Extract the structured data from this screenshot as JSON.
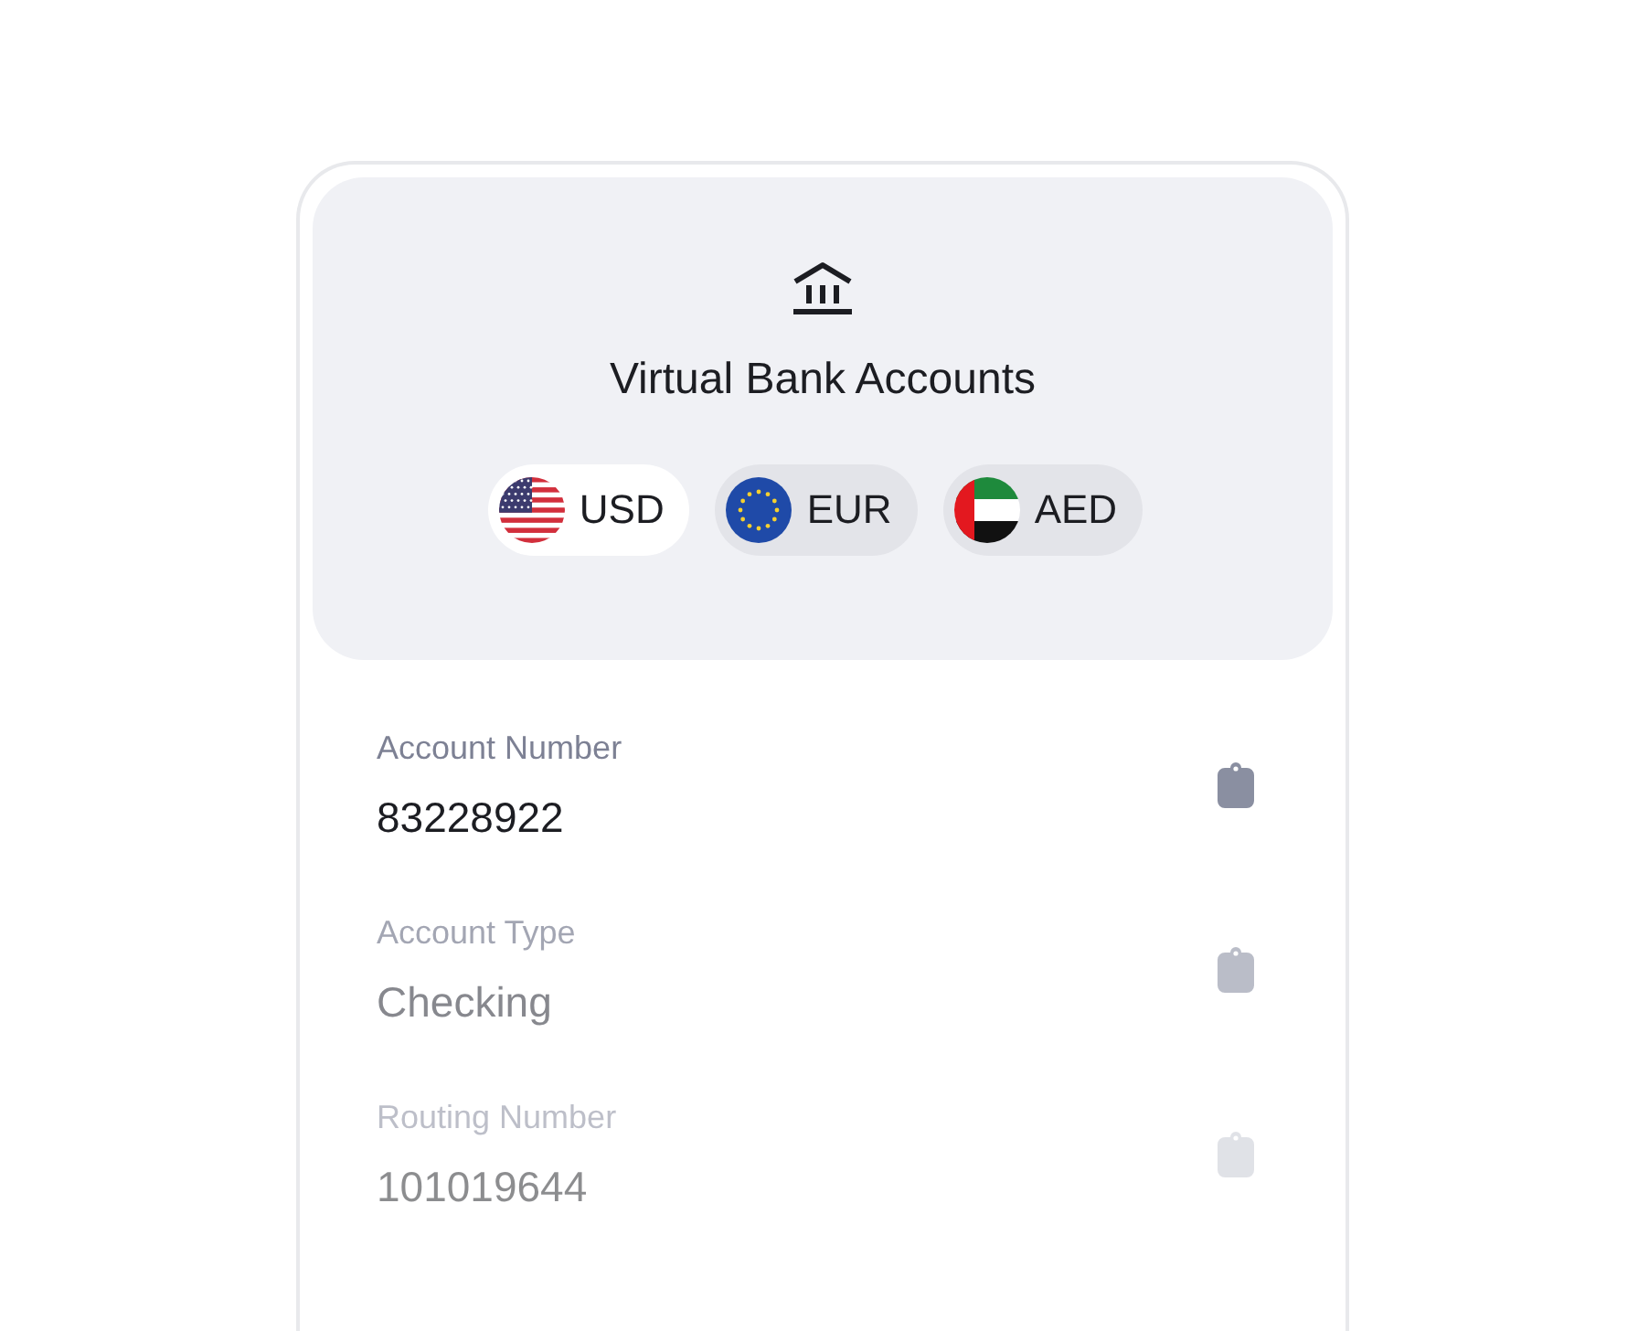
{
  "header": {
    "title": "Virtual Bank Accounts"
  },
  "currencies": [
    {
      "label": "USD",
      "kind": "us",
      "selected": true
    },
    {
      "label": "EUR",
      "kind": "eu",
      "selected": false
    },
    {
      "label": "AED",
      "kind": "ae",
      "selected": false
    }
  ],
  "fields": [
    {
      "label": "Account Number",
      "value": "83228922"
    },
    {
      "label": "Account Type",
      "value": "Checking"
    },
    {
      "label": "Routing Number",
      "value": "101019644"
    }
  ]
}
